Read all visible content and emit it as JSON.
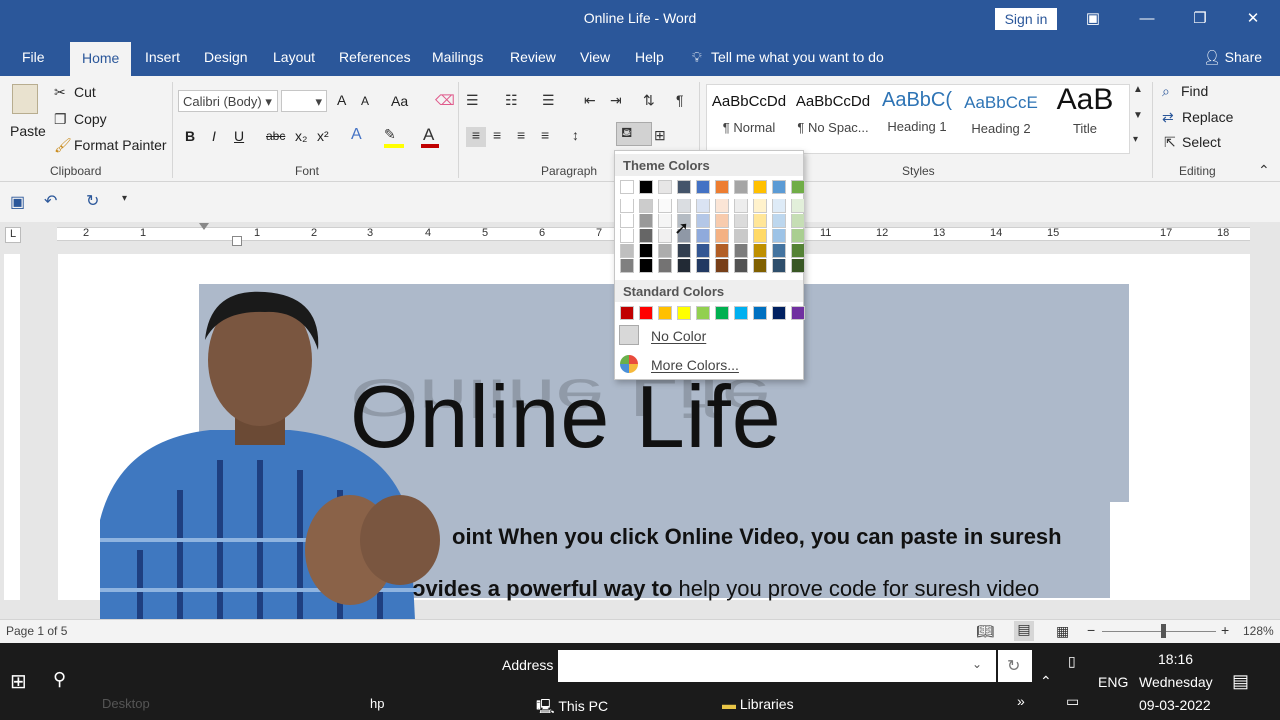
{
  "window": {
    "title": "Online Life  -  Word",
    "sign_in": "Sign in"
  },
  "tabs": [
    "File",
    "Home",
    "Insert",
    "Design",
    "Layout",
    "References",
    "Mailings",
    "Review",
    "View",
    "Help"
  ],
  "tell_me": "Tell me what you want to do",
  "share": "Share",
  "clipboard": {
    "paste": "Paste",
    "cut": "Cut",
    "copy": "Copy",
    "format_painter": "Format Painter",
    "label": "Clipboard"
  },
  "font": {
    "name": "Calibri (Body)",
    "size": "",
    "label": "Font",
    "bold": "B",
    "italic": "I",
    "underline": "U",
    "strike": "abc",
    "sub": "x₂",
    "sup": "x²",
    "grow": "A",
    "shrink": "A",
    "case": "Aa"
  },
  "paragraph": {
    "label": "Paragraph"
  },
  "styles": {
    "label": "Styles",
    "items": [
      {
        "preview": "AaBbCcDd",
        "name": "¶ Normal",
        "color": "#111111"
      },
      {
        "preview": "AaBbCcDd",
        "name": "¶ No Spac...",
        "color": "#111111"
      },
      {
        "preview": "AaBbC(",
        "name": "Heading 1",
        "color": "#2e74b5"
      },
      {
        "preview": "AaBbCcE",
        "name": "Heading 2",
        "color": "#2e74b5"
      },
      {
        "preview": "AaB",
        "name": "Title",
        "color": "#111111"
      }
    ]
  },
  "editing": {
    "find": "Find",
    "replace": "Replace",
    "select": "Select",
    "label": "Editing"
  },
  "ruler": {
    "numbers": [
      "2",
      "1",
      "1",
      "2",
      "3",
      "4",
      "5",
      "6",
      "7",
      "11",
      "12",
      "13",
      "14",
      "15",
      "17",
      "18"
    ]
  },
  "document": {
    "title": "Online Life",
    "line1": "oint When you click Online Video, you can paste in suresh",
    "line2_bold": "ovides a powerful way to",
    "line2_rest": " help you prove code for suresh video"
  },
  "shading_menu": {
    "theme_header": "Theme Colors",
    "standard_header": "Standard Colors",
    "no_color": "No Color",
    "more_colors": "More Colors...",
    "theme_colors": [
      "#ffffff",
      "#000000",
      "#e7e6e6",
      "#44546a",
      "#4472c4",
      "#ed7d31",
      "#a5a5a5",
      "#ffc000",
      "#5b9bd5",
      "#70ad47"
    ],
    "standard_colors": [
      "#c00000",
      "#ff0000",
      "#ffc000",
      "#ffff00",
      "#92d050",
      "#00b050",
      "#00b0f0",
      "#0070c0",
      "#002060",
      "#7030a0"
    ]
  },
  "status": {
    "page": "Page 1 of 5",
    "zoom": "128%"
  },
  "taskbar": {
    "address_label": "Address",
    "this_pc": "This PC",
    "libraries": "Libraries",
    "desktop": "Desktop",
    "hp": "hp",
    "lang": "ENG",
    "time": "18:16",
    "day": "Wednesday",
    "date": "09-03-2022"
  }
}
